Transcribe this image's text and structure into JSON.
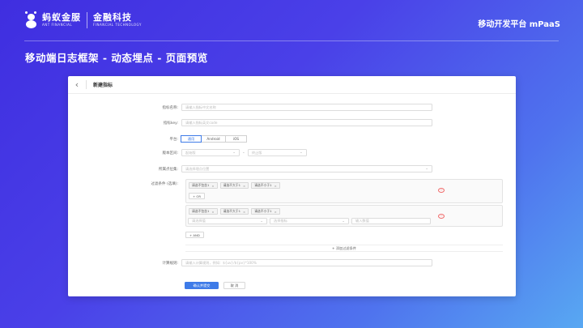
{
  "brand": {
    "ant_cn": "蚂蚁金服",
    "ant_en": "ANT FINANCIAL",
    "fin_cn": "金融科技",
    "fin_en": "FINANCIAL TECHNOLOGY"
  },
  "platform": "移动开发平台 mPaaS",
  "slide_title": "移动端日志框架 - 动态埋点 - 页面预览",
  "panel": {
    "back_glyph": "‹",
    "title": "新建指标",
    "fields": {
      "name": {
        "label": "指标名称:",
        "placeholder": "请输入指标中文名称"
      },
      "key": {
        "label": "指标key:",
        "placeholder": "请输入指标英文code"
      },
      "platform": {
        "label": "平台:",
        "options": [
          "通用",
          "Android",
          "iOS"
        ],
        "selected": "通用"
      },
      "version": {
        "label": "版本区间:",
        "from_placeholder": "起始版",
        "separator": "-",
        "to_placeholder": "终止版"
      },
      "event": {
        "label": "所属点位集:",
        "placeholder": "请选择埋点位置"
      },
      "filter": {
        "label": "过滤条件 (选填):",
        "group1": {
          "tags": [
            "请选不包含1",
            "请选不大于1",
            "请选不小于1"
          ],
          "or_button": "+ OR"
        },
        "group2": {
          "tags": [
            "请选不包含1",
            "请选不大于1",
            "请选不小于1"
          ],
          "selects": [
            "请选择值",
            "选择指标",
            "输入数值"
          ]
        },
        "and_button": "+ AND",
        "add_condition": "+ 添加过滤条件"
      },
      "formula": {
        "label": "计算规则:",
        "placeholder": "请输入计算规则，例如：${uv}/${pv}*100%"
      }
    },
    "buttons": {
      "submit": "确认并提交",
      "cancel": "取 消"
    }
  },
  "colors": {
    "primary": "#3e7be8",
    "danger": "#f06767"
  }
}
